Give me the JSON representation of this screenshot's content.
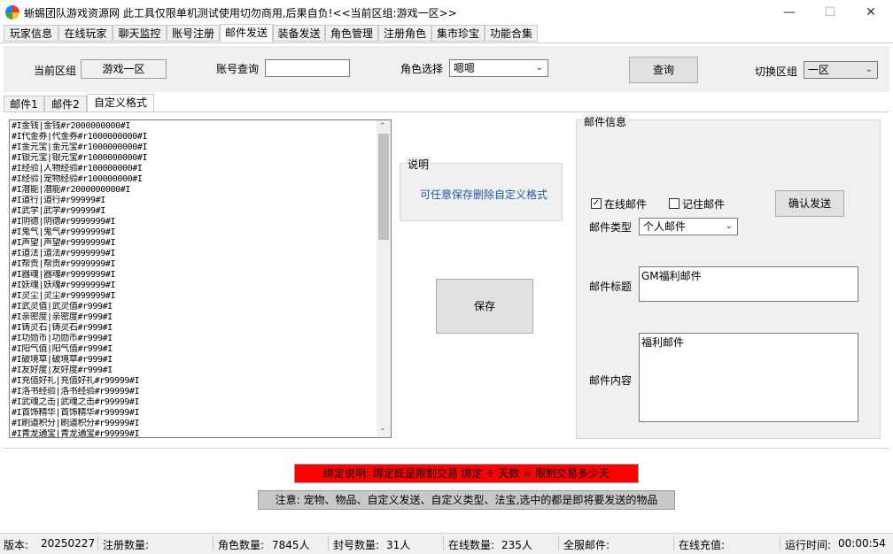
{
  "window": {
    "title": "蜥蜴团队游戏资源网 此工具仅限单机测试使用切勿商用,后果自负!<<当前区组:游戏一区>>",
    "minimize": "—",
    "maximize": "☐",
    "close": "✕"
  },
  "main_tabs": [
    "玩家信息",
    "在线玩家",
    "聊天监控",
    "账号注册",
    "邮件发送",
    "装备发送",
    "角色管理",
    "注册角色",
    "集市珍宝",
    "功能合集"
  ],
  "active_main_tab": "邮件发送",
  "toolbar": {
    "region_label": "当前区组",
    "region_value": "游戏一区",
    "account_label": "账号查询",
    "account_value": "",
    "role_label": "角色选择",
    "role_value": "嗯嗯",
    "query_button": "查询",
    "switch_label": "切换区组",
    "switch_value": "一区"
  },
  "sub_tabs": [
    "邮件1",
    "邮件2",
    "自定义格式"
  ],
  "active_sub_tab": "自定义格式",
  "custom_lines": [
    "#I金钱|金钱#r2000000000#I",
    "#I代金券|代金券#r1000000000#I",
    "#I金元宝|金元宝#r1000000000#I",
    "#I银元宝|银元宝#r1000000000#I",
    "#I经验|人物经验#r100000000#I",
    "#I经验|宠物经验#r100000000#I",
    "#I潜能|潜能#r2000000000#I",
    "#I道行|道行#r99999#I",
    "#I武学|武学#r99999#I",
    "#I阴德|阴德#r9999999#I",
    "#I鬼气|鬼气#r9999999#I",
    "#I声望|声望#r9999999#I",
    "#I道法|道法#r9999999#I",
    "#I帮贡|帮贡#r9999999#I",
    "#I器魂|器魂#r9999999#I",
    "#I妖魂|妖魂#r9999999#I",
    "#I灵尘|灵尘#r9999999#I",
    "#I武灵值|武灵值#r999#I",
    "#I亲密度|亲密度#r999#I",
    "#I铸灵石|铸灵石#r999#I",
    "#I功勋币|功勋币#r999#I",
    "#I阳气值|阳气值#r999#I",
    "#I破境草|破境草#r999#I",
    "#I友好度|友好度#r999#I",
    "#I充值好礼|充值好礼#r99999#I",
    "#I洛书经验|洛书经验#r99999#I",
    "#I武魂之击|武魂之击#r99999#I",
    "#I首饰精华|首饰精华#r99999#I",
    "#I刷道积分|刷道积分#r99999#I",
    "#I青龙通宝|青龙通宝#r99999#I"
  ],
  "explain": {
    "title": "说明",
    "text": "可任意保存删除自定义格式"
  },
  "save_button": "保存",
  "mail_info": {
    "title": "邮件信息",
    "online_mail": "在线邮件",
    "online_checked": true,
    "remember_mail": "记住邮件",
    "remember_checked": false,
    "confirm_button": "确认发送",
    "type_label": "邮件类型",
    "type_value": "个人邮件",
    "subject_label": "邮件标题",
    "subject_value": "GM福利邮件",
    "content_label": "邮件内容",
    "content_value": "福利邮件"
  },
  "bind_note": "绑定说明: 绑定既是限制交易 绑定 + 天数 = 限制交易多少天",
  "notice": "注意: 宠物、物品、自定义发送、自定义类型、法宝,选中的都是即将要发送的物品",
  "colors": {
    "bind_note_bg": "#ff0000",
    "notice_bg": "#c8c8c8",
    "explain_text": "#1f5aa6"
  },
  "status": {
    "version_label": "版本:",
    "version_value": "20250227",
    "register_label": "注册数量:",
    "register_value": "",
    "role_label": "角色数量:",
    "role_value": "7845人",
    "ban_label": "封号数量:",
    "ban_value": "31人",
    "online_label": "在线数量:",
    "online_value": "235人",
    "fullmail_label": "全服邮件:",
    "fullmail_value": "",
    "recharge_label": "在线充值:",
    "recharge_value": "",
    "runtime_label": "运行时间:",
    "runtime_value": "00:00:54"
  }
}
